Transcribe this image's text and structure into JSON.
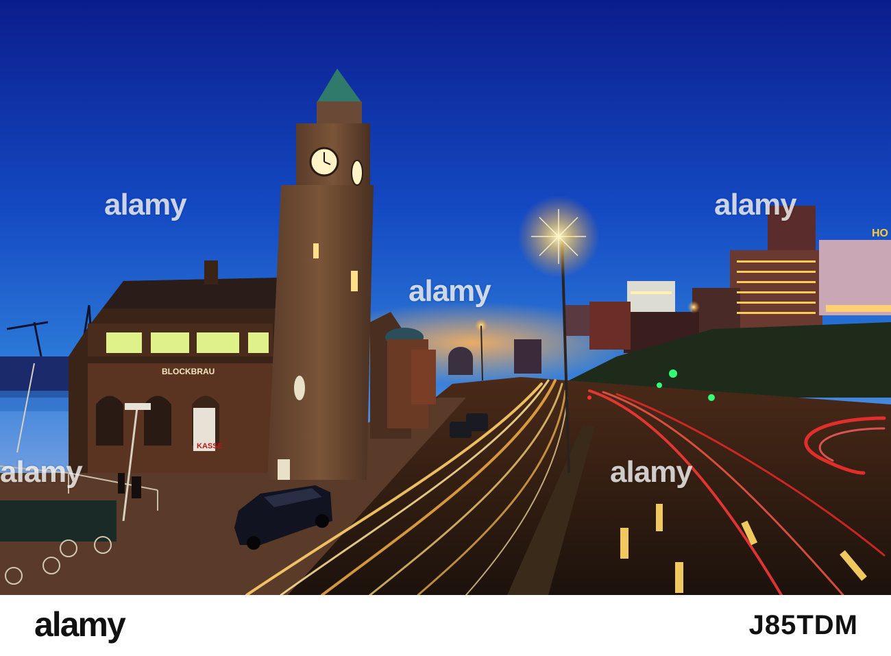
{
  "scene": {
    "signs": {
      "restaurant": "BLOCKBRAU",
      "ticket": "KASSE",
      "hotel_fragment": "HO"
    },
    "watermark_text": "alamy"
  },
  "footer": {
    "logo": "alamy",
    "caption": "",
    "image_id": "J85TDM"
  }
}
